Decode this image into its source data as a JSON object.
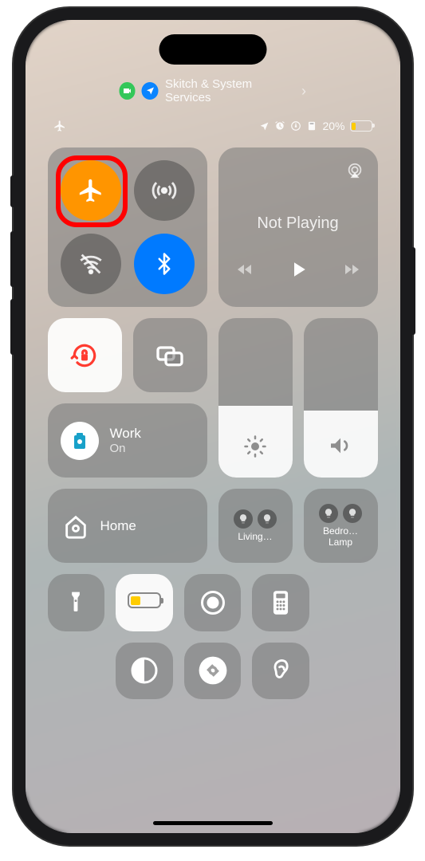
{
  "status": {
    "top_app_label": "Skitch & System Services",
    "battery_percent": "20%",
    "battery_level": 20
  },
  "connectivity": {
    "airplane_mode": true,
    "cellular": false,
    "wifi": false,
    "bluetooth": true
  },
  "media": {
    "title": "Not Playing"
  },
  "focus": {
    "name": "Work",
    "state": "On"
  },
  "brightness": {
    "level": 45
  },
  "volume": {
    "level": 42
  },
  "home": {
    "label": "Home",
    "accessory1": "Living…",
    "accessory2_line1": "Bedro…",
    "accessory2_line2": "Lamp"
  },
  "annotation": {
    "highlighted": "airplane-mode"
  }
}
